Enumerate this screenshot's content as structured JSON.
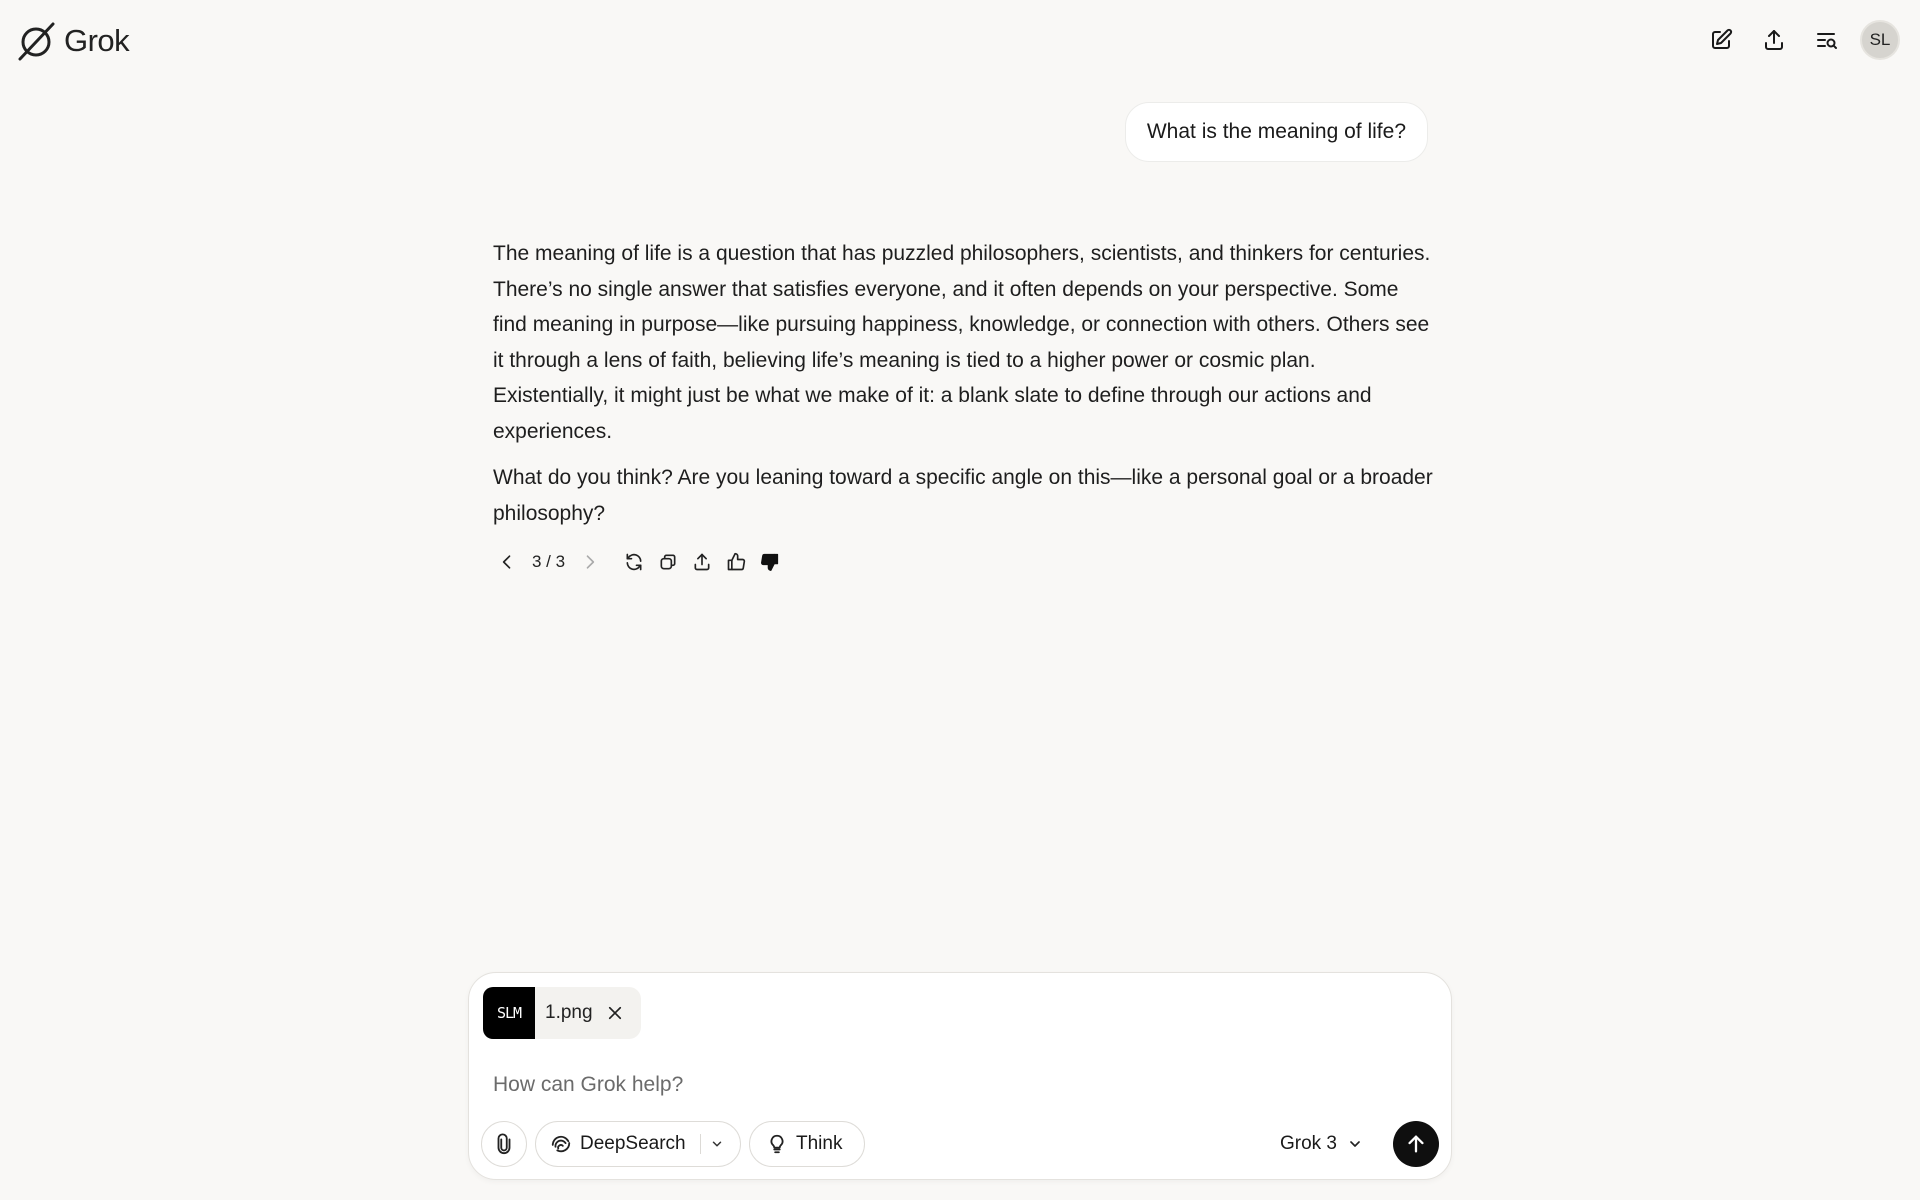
{
  "app": {
    "name": "Grok"
  },
  "header": {
    "user_initials": "SL",
    "icons": [
      "edit-icon",
      "share-icon",
      "history-search-icon"
    ]
  },
  "conversation": {
    "user_message": "What is the meaning of life?",
    "assistant_paragraphs": [
      "The meaning of life is a question that has puzzled philosophers, scientists, and thinkers for centuries. There’s no single answer that satisfies everyone, and it often depends on your perspective. Some find meaning in purpose—like pursuing happiness, knowledge, or connection with others. Others see it through a lens of faith, believing life’s meaning is tied to a higher power or cosmic plan. Existentially, it might just be what we make of it: a blank slate to define through our actions and experiences.",
      "What do you think? Are you leaning toward a specific angle on this—like a personal goal or a broader philosophy?"
    ],
    "pager": "3 / 3",
    "actions": [
      "prev-icon",
      "next-icon",
      "regenerate-icon",
      "copy-icon",
      "share-icon",
      "thumbs-up-icon",
      "thumbs-down-icon"
    ]
  },
  "composer": {
    "attachment": {
      "thumb_text": "SLM",
      "filename": "1.png"
    },
    "placeholder": "How can Grok help?",
    "deepsearch_label": "DeepSearch",
    "think_label": "Think",
    "model_label": "Grok 3"
  }
}
